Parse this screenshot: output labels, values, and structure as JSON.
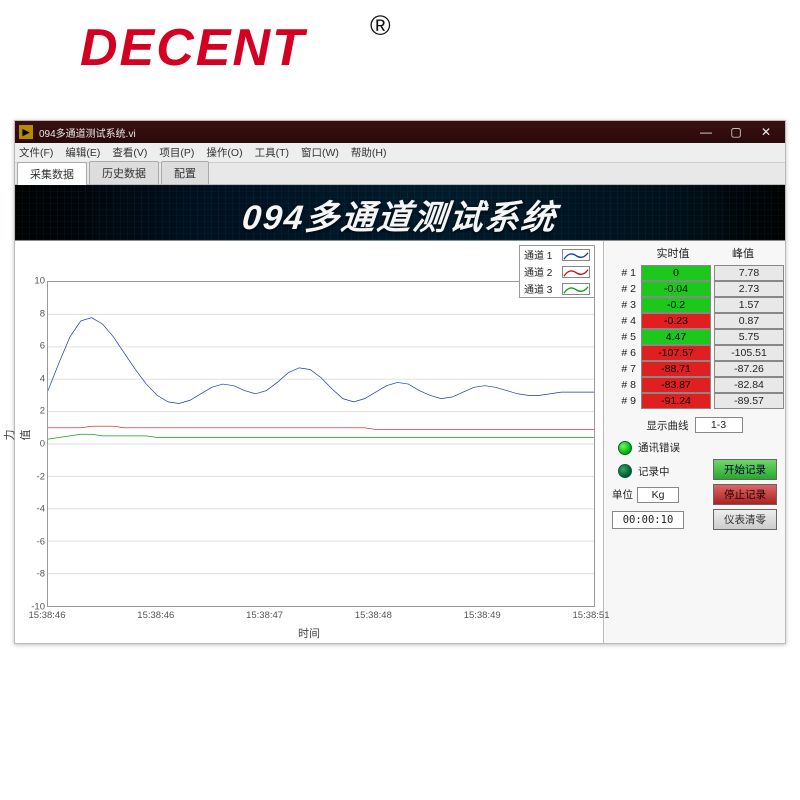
{
  "brand": "DECENT",
  "registered": "®",
  "window": {
    "title": "094多通道测试系统.vi",
    "controls": {
      "min": "—",
      "max": "▢",
      "close": "✕"
    }
  },
  "menu": [
    "文件(F)",
    "编辑(E)",
    "查看(V)",
    "项目(P)",
    "操作(O)",
    "工具(T)",
    "窗口(W)",
    "帮助(H)"
  ],
  "tabs": [
    "采集数据",
    "历史数据",
    "配置"
  ],
  "banner": "094多通道测试系统",
  "legend": [
    {
      "label": "通道 1",
      "color": "#1a3aa8"
    },
    {
      "label": "通道 2",
      "color": "#d01010"
    },
    {
      "label": "通道 3",
      "color": "#10a010"
    }
  ],
  "side": {
    "col_rt": "实时值",
    "col_pk": "峰值",
    "rows": [
      {
        "n": "# 1",
        "rt": "0",
        "rt_color": "green",
        "pk": "7.78"
      },
      {
        "n": "# 2",
        "rt": "-0.04",
        "rt_color": "green",
        "pk": "2.73"
      },
      {
        "n": "# 3",
        "rt": "-0.2",
        "rt_color": "green",
        "pk": "1.57"
      },
      {
        "n": "# 4",
        "rt": "-0.23",
        "rt_color": "red",
        "pk": "0.87"
      },
      {
        "n": "# 5",
        "rt": "4.47",
        "rt_color": "green",
        "pk": "5.75"
      },
      {
        "n": "# 6",
        "rt": "-107.57",
        "rt_color": "red",
        "pk": "-105.51"
      },
      {
        "n": "# 7",
        "rt": "-88.71",
        "rt_color": "red",
        "pk": "-87.26"
      },
      {
        "n": "# 8",
        "rt": "-83.87",
        "rt_color": "red",
        "pk": "-82.84"
      },
      {
        "n": "# 9",
        "rt": "-91.24",
        "rt_color": "red",
        "pk": "-89.57"
      }
    ],
    "disp_label": "显示曲线",
    "disp_value": "1-3",
    "comm_err": "通讯错误",
    "recording": "记录中",
    "start_rec": "开始记录",
    "stop_rec": "停止记录",
    "unit_label": "单位",
    "unit_value": "Kg",
    "timer": "00:00:10",
    "zero": "仪表清零"
  },
  "axes": {
    "ylabel": "力值",
    "xlabel": "时间",
    "yticks": [
      10,
      8,
      6,
      4,
      2,
      0,
      -2,
      -4,
      -6,
      -8,
      -10
    ],
    "xticks": [
      "15:38:46",
      "15:38:46",
      "15:38:47",
      "15:38:48",
      "15:38:49",
      "15:38:51"
    ]
  },
  "chart_data": {
    "type": "line",
    "title": "",
    "xlabel": "时间",
    "ylabel": "力值",
    "ylim": [
      -10,
      10
    ],
    "x": [
      0,
      0.1,
      0.2,
      0.3,
      0.4,
      0.5,
      0.6,
      0.7,
      0.8,
      0.9,
      1.0,
      1.1,
      1.2,
      1.3,
      1.4,
      1.5,
      1.6,
      1.7,
      1.8,
      1.9,
      2.0,
      2.1,
      2.2,
      2.3,
      2.4,
      2.5,
      2.6,
      2.7,
      2.8,
      2.9,
      3.0,
      3.1,
      3.2,
      3.3,
      3.4,
      3.5,
      3.6,
      3.7,
      3.8,
      3.9,
      4.0,
      4.1,
      4.2,
      4.3,
      4.4,
      4.5,
      4.6,
      4.7,
      4.8,
      4.9,
      5.0
    ],
    "x_tick_labels": [
      "15:38:46",
      "15:38:46",
      "15:38:47",
      "15:38:48",
      "15:38:49",
      "15:38:51"
    ],
    "series": [
      {
        "name": "通道 1",
        "color": "#1a3aa8",
        "values": [
          3.3,
          5.0,
          6.6,
          7.6,
          7.8,
          7.4,
          6.6,
          5.6,
          4.6,
          3.7,
          3.0,
          2.6,
          2.5,
          2.7,
          3.1,
          3.5,
          3.7,
          3.6,
          3.3,
          3.1,
          3.3,
          3.8,
          4.4,
          4.7,
          4.6,
          4.1,
          3.4,
          2.8,
          2.6,
          2.8,
          3.2,
          3.6,
          3.8,
          3.7,
          3.3,
          3.0,
          2.8,
          2.9,
          3.2,
          3.5,
          3.6,
          3.5,
          3.3,
          3.1,
          3.0,
          3.0,
          3.1,
          3.2,
          3.2,
          3.2,
          3.2
        ]
      },
      {
        "name": "通道 2",
        "color": "#d01010",
        "values": [
          1.0,
          1.0,
          1.0,
          1.0,
          1.1,
          1.1,
          1.1,
          1.0,
          1.0,
          1.0,
          1.0,
          1.0,
          1.0,
          1.0,
          1.0,
          1.0,
          1.0,
          1.0,
          1.0,
          1.0,
          1.0,
          1.0,
          1.0,
          1.0,
          1.0,
          1.0,
          1.0,
          1.0,
          1.0,
          1.0,
          0.9,
          0.9,
          0.9,
          0.9,
          0.9,
          0.9,
          0.9,
          0.9,
          0.9,
          0.9,
          0.9,
          0.9,
          0.9,
          0.9,
          0.9,
          0.9,
          0.9,
          0.9,
          0.9,
          0.9,
          0.9
        ]
      },
      {
        "name": "通道 3",
        "color": "#10a010",
        "values": [
          0.3,
          0.4,
          0.5,
          0.6,
          0.6,
          0.5,
          0.5,
          0.5,
          0.5,
          0.5,
          0.4,
          0.4,
          0.4,
          0.4,
          0.4,
          0.4,
          0.4,
          0.4,
          0.4,
          0.4,
          0.4,
          0.4,
          0.4,
          0.4,
          0.4,
          0.4,
          0.4,
          0.4,
          0.4,
          0.4,
          0.4,
          0.4,
          0.4,
          0.4,
          0.4,
          0.4,
          0.4,
          0.4,
          0.4,
          0.4,
          0.4,
          0.4,
          0.4,
          0.4,
          0.4,
          0.4,
          0.4,
          0.4,
          0.4,
          0.4,
          0.4
        ]
      }
    ]
  }
}
